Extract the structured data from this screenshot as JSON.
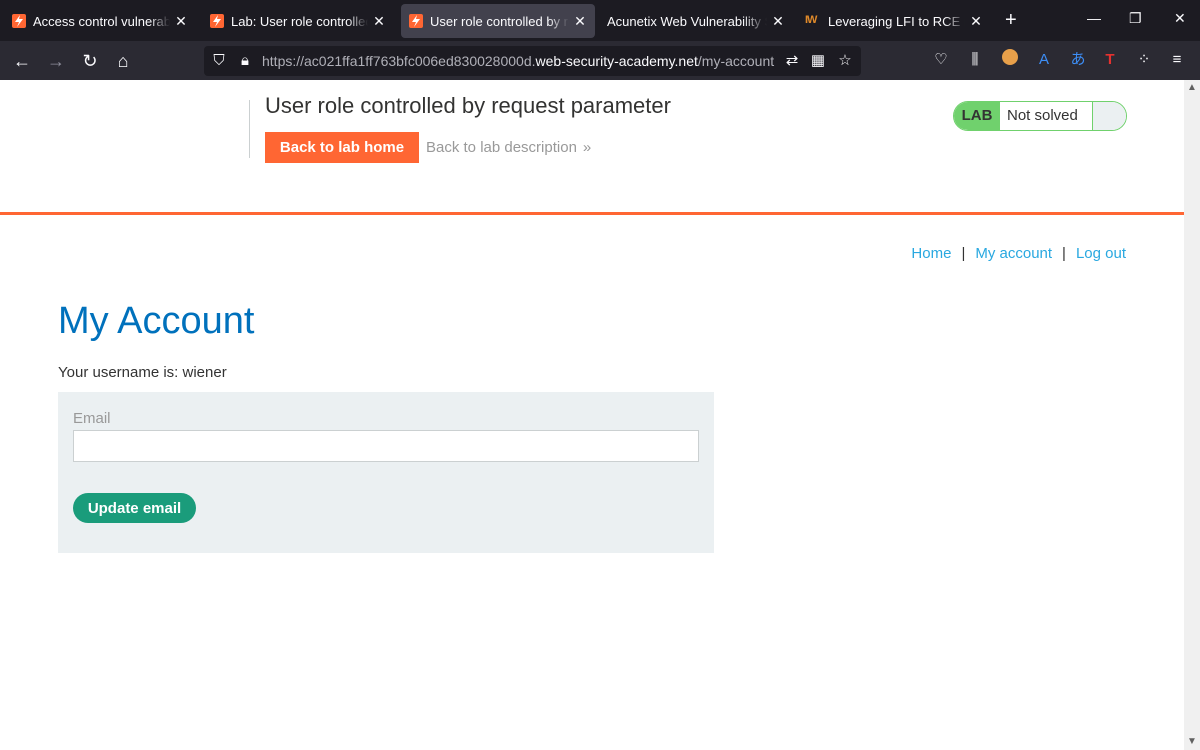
{
  "browser": {
    "tabs": [
      {
        "label": "Access control vulnerabilities",
        "favicon": "portswigger-icon",
        "active": false
      },
      {
        "label": "Lab: User role controlled by r",
        "favicon": "portswigger-icon",
        "active": false
      },
      {
        "label": "User role controlled by reque",
        "favicon": "portswigger-icon",
        "active": true
      },
      {
        "label": "Acunetix Web Vulnerability Scanne",
        "favicon": "none",
        "active": false
      },
      {
        "label": "Leveraging LFI to RCE in a we",
        "favicon": "iw-icon",
        "iw_text": "IW",
        "active": false
      }
    ],
    "url_prefix": "https://ac021ffa1ff763bfc006ed830028000d.",
    "url_domain": "web-security-academy.net",
    "url_path": "/my-account"
  },
  "lab_header": {
    "title": "User role controlled by request parameter",
    "back_home_label": "Back to lab home",
    "back_description_label": "Back to lab description",
    "status_badge": "LAB",
    "status_text": "Not solved"
  },
  "nav": {
    "home": "Home",
    "separator": "|",
    "my_account": "My account",
    "log_out": "Log out"
  },
  "main": {
    "heading": "My Account",
    "username_line": "Your username is: wiener",
    "email_label": "Email",
    "email_value": "",
    "update_button": "Update email"
  },
  "colors": {
    "accent_orange": "#ff6633",
    "link_blue": "#29a8e0",
    "heading_blue": "#0071bc",
    "status_green": "#70d16d",
    "button_teal": "#1a9c7b"
  }
}
